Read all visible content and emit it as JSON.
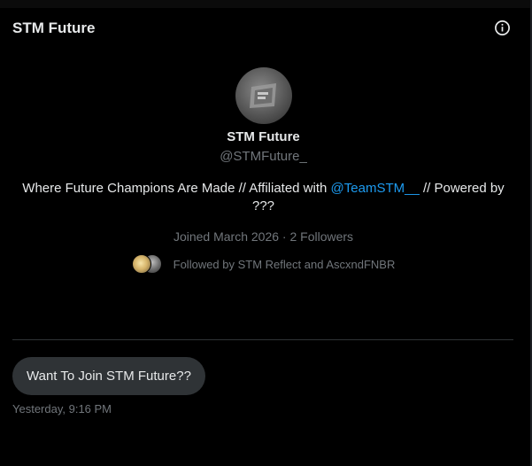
{
  "header": {
    "title": "STM Future",
    "info_icon": "info-circle-icon"
  },
  "profile": {
    "display_name": "STM Future",
    "handle": "@STMFuture_",
    "bio_before": "Where Future Champions Are Made // Affiliated with ",
    "bio_mention": "@TeamSTM__",
    "bio_after": " // Powered by ???",
    "joined": "Joined March 2026",
    "separator": " · ",
    "followers": "2 Followers",
    "followed_by": "Followed by STM Reflect and AscxndFNBR"
  },
  "messages": [
    {
      "text": "Want To Join STM Future??",
      "timestamp": "Yesterday, 9:16 PM"
    }
  ],
  "colors": {
    "background": "#000000",
    "text": "#e7e9ea",
    "muted": "#71767b",
    "accent": "#1d9bf0",
    "bubble": "#2f3336"
  }
}
